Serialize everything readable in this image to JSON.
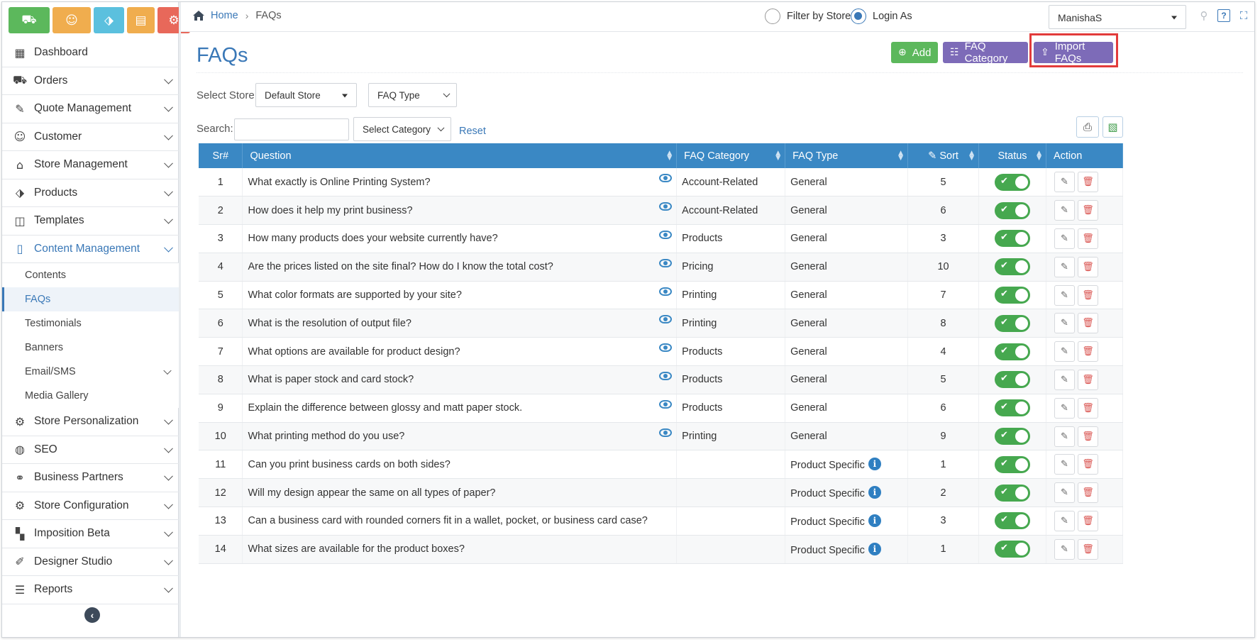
{
  "quick_buttons": [
    {
      "icon": "cart-icon",
      "glyph": "🛒",
      "color": "#5cb85c"
    },
    {
      "icon": "user-icon",
      "glyph": "👤",
      "color": "#f0ad4e"
    },
    {
      "icon": "tag-icon",
      "glyph": "🏷",
      "color": "#5bc0de"
    },
    {
      "icon": "document-icon",
      "glyph": "📄",
      "color": "#f0ad4e"
    },
    {
      "icon": "settings-icon",
      "glyph": "⚙",
      "color": "#e8685a"
    }
  ],
  "sidebar": {
    "items": [
      {
        "label": "Dashboard",
        "icon": "dashboard-icon"
      },
      {
        "label": "Orders",
        "icon": "cart-icon"
      },
      {
        "label": "Quote Management",
        "icon": "quote-icon"
      },
      {
        "label": "Customer",
        "icon": "user-icon"
      },
      {
        "label": "Store Management",
        "icon": "store-icon"
      },
      {
        "label": "Products",
        "icon": "tag-icon"
      },
      {
        "label": "Templates",
        "icon": "template-icon"
      },
      {
        "label": "Content Management",
        "icon": "file-icon"
      },
      {
        "label": "Store Personalization",
        "icon": "gear-icon"
      },
      {
        "label": "SEO",
        "icon": "globe-icon"
      },
      {
        "label": "Business Partners",
        "icon": "handshake-icon"
      },
      {
        "label": "Store Configuration",
        "icon": "cogs-icon"
      },
      {
        "label": "Imposition Beta",
        "icon": "grid-icon"
      },
      {
        "label": "Designer Studio",
        "icon": "palette-icon"
      },
      {
        "label": "Reports",
        "icon": "chart-icon"
      }
    ],
    "sub_items": [
      {
        "label": "Contents"
      },
      {
        "label": "FAQs"
      },
      {
        "label": "Testimonials"
      },
      {
        "label": "Banners"
      },
      {
        "label": "Email/SMS"
      },
      {
        "label": "Media Gallery"
      }
    ]
  },
  "breadcrumb": {
    "home": "Home",
    "current": "FAQs"
  },
  "topbar": {
    "filter_by_store": "Filter by Store",
    "login_as": "Login As",
    "user": "ManishaS"
  },
  "page": {
    "title": "FAQs",
    "add": "Add",
    "faq_category": "FAQ Category",
    "import_faqs": "Import FAQs",
    "select_store_label": "Select Store",
    "store_value": "Default Store",
    "faq_type_value": "FAQ Type",
    "search_label": "Search:",
    "category_value": "Select Category",
    "reset": "Reset"
  },
  "table": {
    "headers": [
      "Sr#",
      "Question",
      "FAQ Category",
      "FAQ Type",
      "Sort",
      "Status",
      "Action"
    ],
    "rows": [
      {
        "sr": "1",
        "q": "What exactly is Online Printing System?",
        "cat": "Account-Related",
        "type": "General",
        "sort": "5"
      },
      {
        "sr": "2",
        "q": "How does it help my print business?",
        "cat": "Account-Related",
        "type": "General",
        "sort": "6"
      },
      {
        "sr": "3",
        "q": "How many products does your website currently have?",
        "cat": "Products",
        "type": "General",
        "sort": "3"
      },
      {
        "sr": "4",
        "q": "Are the prices listed on the site final? How do I know the total cost?",
        "cat": "Pricing",
        "type": "General",
        "sort": "10"
      },
      {
        "sr": "5",
        "q": "What color formats are supported by your site?",
        "cat": "Printing",
        "type": "General",
        "sort": "7"
      },
      {
        "sr": "6",
        "q": "What is the resolution of output file?",
        "cat": "Printing",
        "type": "General",
        "sort": "8"
      },
      {
        "sr": "7",
        "q": "What options are available for product design?",
        "cat": "Products",
        "type": "General",
        "sort": "4"
      },
      {
        "sr": "8",
        "q": "What is paper stock and card stock?",
        "cat": "Products",
        "type": "General",
        "sort": "5"
      },
      {
        "sr": "9",
        "q": "Explain the difference between glossy and matt paper stock.",
        "cat": "Products",
        "type": "General",
        "sort": "6"
      },
      {
        "sr": "10",
        "q": "What printing method do you use?",
        "cat": "Printing",
        "type": "General",
        "sort": "9"
      },
      {
        "sr": "11",
        "q": "Can you print business cards on both sides?",
        "cat": "",
        "type": "Product Specific",
        "sort": "1"
      },
      {
        "sr": "12",
        "q": "Will my design appear the same on all types of paper?",
        "cat": "",
        "type": "Product Specific",
        "sort": "2"
      },
      {
        "sr": "13",
        "q": "Can a business card with rounded corners fit in a wallet, pocket, or business card case?",
        "cat": "",
        "type": "Product Specific",
        "sort": "3"
      },
      {
        "sr": "14",
        "q": "What sizes are available for the product boxes?",
        "cat": "",
        "type": "Product Specific",
        "sort": "1"
      }
    ]
  },
  "colors": {
    "accent": "#3a78b7",
    "header": "#3a88c4",
    "add": "#5cb85c",
    "purple": "#7d6bb8",
    "highlight": "#e23b3b"
  }
}
